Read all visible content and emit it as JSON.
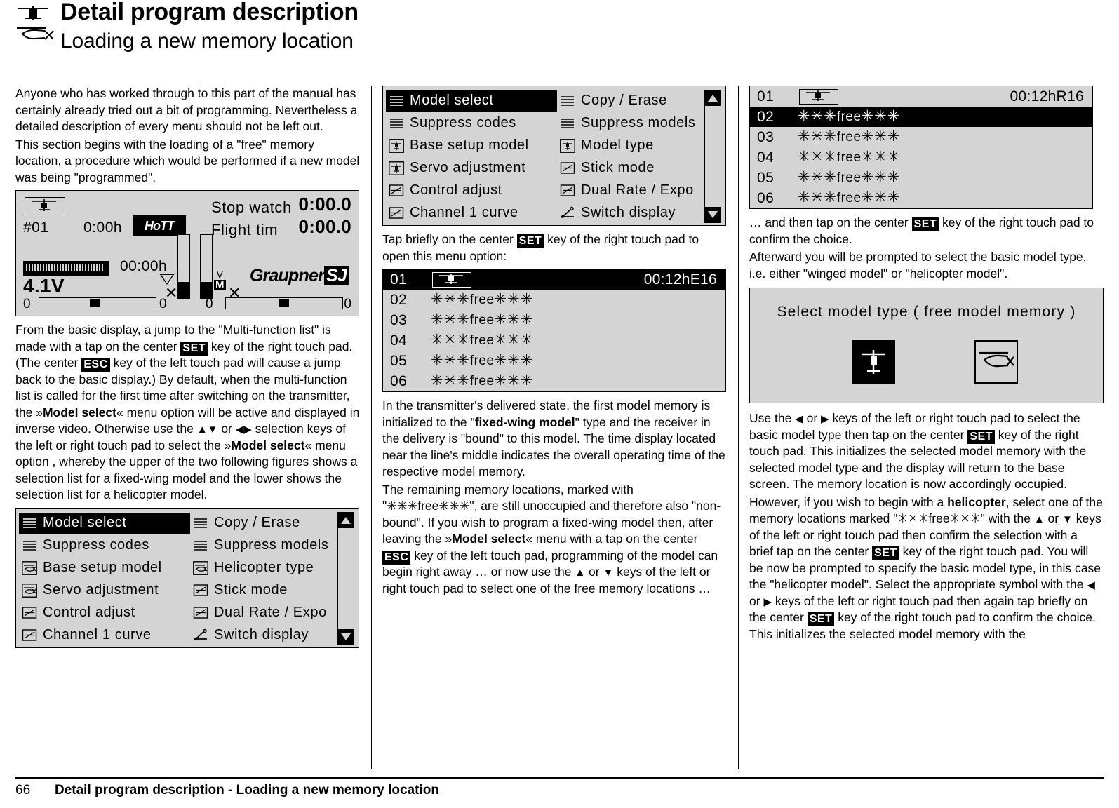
{
  "header": {
    "title": "Detail program description",
    "subtitle": "Loading a new memory location",
    "icon": "helicopter-icon"
  },
  "footer": {
    "page_number": "66",
    "text": "Detail program description - Loading a new memory location"
  },
  "column1": {
    "p1": "Anyone who has worked through to this part of the manual has certainly already tried out a bit of programming. Nevertheless a detailed description of every menu should not be left out.",
    "p2": "This section begins with the loading of a \"free\" memory location, a procedure which would be performed if a new model was being \"programmed\".",
    "p3_a": "From the basic display, a jump to the \"Multi-function list\" is made with a tap on the center ",
    "p3_key_set": "SET",
    "p3_b": " key of the right touch pad. (The center ",
    "p3_key_esc": "ESC",
    "p3_c": " key of the left touch pad will cause a jump back to the basic display.) By default, when the multi-function list is called for the first time after switching on the transmitter, the »",
    "p3_bold1": "Model select",
    "p3_d": "« menu option will be active and displayed in inverse video. Otherwise use the ",
    "p3_e": " or ",
    "p3_f": " selection keys of the left or right touch pad to select the »",
    "p3_bold2": "Model select",
    "p3_g": "« menu option , whereby the upper of the two following figures shows a selection list for a fixed-wing model and the lower shows the selection list for a helicopter model."
  },
  "basic_display": {
    "name": "basic-display-screen",
    "model_number": "#01",
    "model_time": "0:00h",
    "hott_label": "HoTT",
    "stop_watch_label": "Stop watch",
    "stop_watch_value": "0:00.0",
    "flight_time_label": "Flight tim",
    "flight_time_value": "0:00.0",
    "operating_time": "00:00h",
    "voltage": "4.1V",
    "brand": "Graupner",
    "brand_suffix": "SJ",
    "trim_zero_1": "0",
    "trim_zero_2": "0",
    "trim_zero_3": "0",
    "trim_zero_4": "0",
    "stick_v": "V",
    "stick_m": "M"
  },
  "multifunction_fixed_wing": {
    "name": "multifunction-list-fixed-wing",
    "rows": [
      {
        "left": "Model select",
        "left_icon": "list-icon",
        "left_highlighted": true,
        "right": "Copy / Erase",
        "right_icon": "list-icon"
      },
      {
        "left": "Suppress codes",
        "left_icon": "list-icon",
        "left_highlighted": false,
        "right": "Suppress models",
        "right_icon": "list-icon"
      },
      {
        "left": "Base setup model",
        "left_icon": "plane-icon",
        "left_highlighted": false,
        "right": "Model type",
        "right_icon": "plane-icon"
      },
      {
        "left": "Servo adjustment",
        "left_icon": "plane-icon",
        "left_highlighted": false,
        "right": "Stick mode",
        "right_icon": "screen-icon"
      },
      {
        "left": "Control adjust",
        "left_icon": "screen-icon",
        "left_highlighted": false,
        "right": "Dual Rate / Expo",
        "right_icon": "screen-icon"
      },
      {
        "left": "Channel 1 curve",
        "left_icon": "screen-icon",
        "left_highlighted": false,
        "right": "Switch display",
        "right_icon": "switch-icon"
      }
    ]
  },
  "multifunction_helicopter": {
    "name": "multifunction-list-helicopter",
    "rows": [
      {
        "left": "Model select",
        "left_icon": "list-icon",
        "left_highlighted": true,
        "right": "Copy / Erase",
        "right_icon": "list-icon"
      },
      {
        "left": "Suppress codes",
        "left_icon": "list-icon",
        "left_highlighted": false,
        "right": "Suppress models",
        "right_icon": "list-icon"
      },
      {
        "left": "Base setup model",
        "left_icon": "heli-icon",
        "left_highlighted": false,
        "right": "Helicopter type",
        "right_icon": "heli-icon"
      },
      {
        "left": "Servo adjustment",
        "left_icon": "heli-icon",
        "left_highlighted": false,
        "right": "Stick mode",
        "right_icon": "screen-icon"
      },
      {
        "left": "Control adjust",
        "left_icon": "screen-icon",
        "left_highlighted": false,
        "right": "Dual Rate / Expo",
        "right_icon": "screen-icon"
      },
      {
        "left": "Channel 1 curve",
        "left_icon": "screen-icon",
        "left_highlighted": false,
        "right": "Switch display",
        "right_icon": "switch-icon"
      }
    ]
  },
  "column2": {
    "p1_a": "Tap briefly on the center ",
    "p1_key": "SET",
    "p1_b": " key of the right touch pad to open this menu option:",
    "p2_a": "In the transmitter's delivered state, the first model memory is initialized to the \"",
    "p2_bold": "fixed-wing model",
    "p2_b": "\" type and the receiver in the delivery is \"bound\" to this model. The time display located near the line's middle indicates the overall operating time of the respective model memory.",
    "p3_a": "The remaining memory locations, marked with \"",
    "p3_free": "free",
    "p3_b": "\", are still unoccupied and therefore also \"non-bound\". If you wish to program a fixed-wing model then, after leaving the »",
    "p3_bold": "Model select",
    "p3_c": "« menu with a tap on the center ",
    "p3_key": "ESC",
    "p3_d": " key of the left touch pad, programming of the model can begin right away … or now use the ",
    "p3_e": " or ",
    "p3_f": " keys of the left or right touch pad to select one of the free memory locations …"
  },
  "memory_list_e16": {
    "name": "model-memory-list-e16",
    "rows": [
      {
        "index": "01",
        "label": "",
        "is_model_icon": true,
        "time": "00:12hE16",
        "highlighted": true
      },
      {
        "index": "02",
        "label": "free",
        "is_model_icon": false,
        "time": "",
        "highlighted": false
      },
      {
        "index": "03",
        "label": "free",
        "is_model_icon": false,
        "time": "",
        "highlighted": false
      },
      {
        "index": "04",
        "label": "free",
        "is_model_icon": false,
        "time": "",
        "highlighted": false
      },
      {
        "index": "05",
        "label": "free",
        "is_model_icon": false,
        "time": "",
        "highlighted": false
      },
      {
        "index": "06",
        "label": "free",
        "is_model_icon": false,
        "time": "",
        "highlighted": false
      }
    ]
  },
  "memory_list_r16": {
    "name": "model-memory-list-r16",
    "rows": [
      {
        "index": "01",
        "label": "",
        "is_model_icon": true,
        "time": "00:12hR16",
        "highlighted": false
      },
      {
        "index": "02",
        "label": "free",
        "is_model_icon": false,
        "time": "",
        "highlighted": true
      },
      {
        "index": "03",
        "label": "free",
        "is_model_icon": false,
        "time": "",
        "highlighted": false
      },
      {
        "index": "04",
        "label": "free",
        "is_model_icon": false,
        "time": "",
        "highlighted": false
      },
      {
        "index": "05",
        "label": "free",
        "is_model_icon": false,
        "time": "",
        "highlighted": false
      },
      {
        "index": "06",
        "label": "free",
        "is_model_icon": false,
        "time": "",
        "highlighted": false
      }
    ]
  },
  "column3": {
    "p1_a": "… and then tap on the center ",
    "p1_key": "SET",
    "p1_b": " key of the right touch pad to confirm the choice.",
    "p2": "Afterward you will be prompted to select the basic model type, i.e. either \"winged model\" or \"helicopter model\".",
    "p3_a": "Use the ",
    "p3_b": " or ",
    "p3_c": " keys of the left or right touch pad to select the basic model type then tap on the center ",
    "p3_key": "SET",
    "p3_d": " key of the right touch pad. This initializes the selected model memory with the selected model type and the display will return to the base screen. The memory location is now accordingly occupied.",
    "p4_a": "However, if you wish to begin with a ",
    "p4_bold1": "helicopter",
    "p4_b": ", select one of the memory locations marked \"",
    "p4_free": "free",
    "p4_c": "\" with the ",
    "p4_d": " or ",
    "p4_e": " keys of the left or right touch pad then confirm the selection with a brief tap on the center ",
    "p4_key1": "SET",
    "p4_f": " key of the right touch pad. You will be now be prompted to specify the basic model type, in this case the \"helicopter model\". Select the appropriate symbol with the ",
    "p4_g": " or ",
    "p4_h": " keys of the left or right touch pad then again tap briefly on the center ",
    "p4_key2": "SET",
    "p4_i": " key of the right touch pad to confirm the choice. This initializes the selected model memory with the"
  },
  "select_model_type": {
    "name": "select-model-type-screen",
    "title": "Select model type ( free  model memory )",
    "left_option_icon": "plane-icon",
    "right_option_icon": "heli-icon"
  }
}
